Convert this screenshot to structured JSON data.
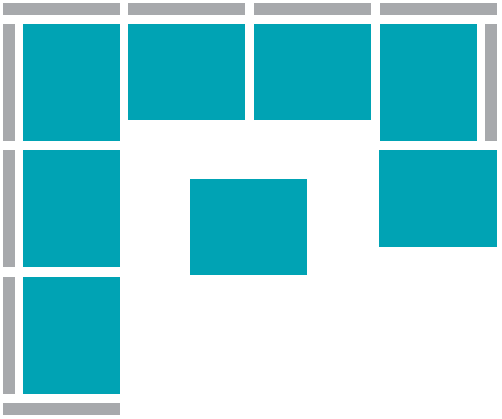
{
  "colors": {
    "background": "#ffffff",
    "backrest": "#a7a9ac",
    "cushion": "#00a3b4"
  },
  "layout_description": {
    "sofa_type": "L-shaped sectional",
    "backrest_segments": 9,
    "seat_modules": 8,
    "ottoman_count": 1,
    "chaise_count": 1
  }
}
